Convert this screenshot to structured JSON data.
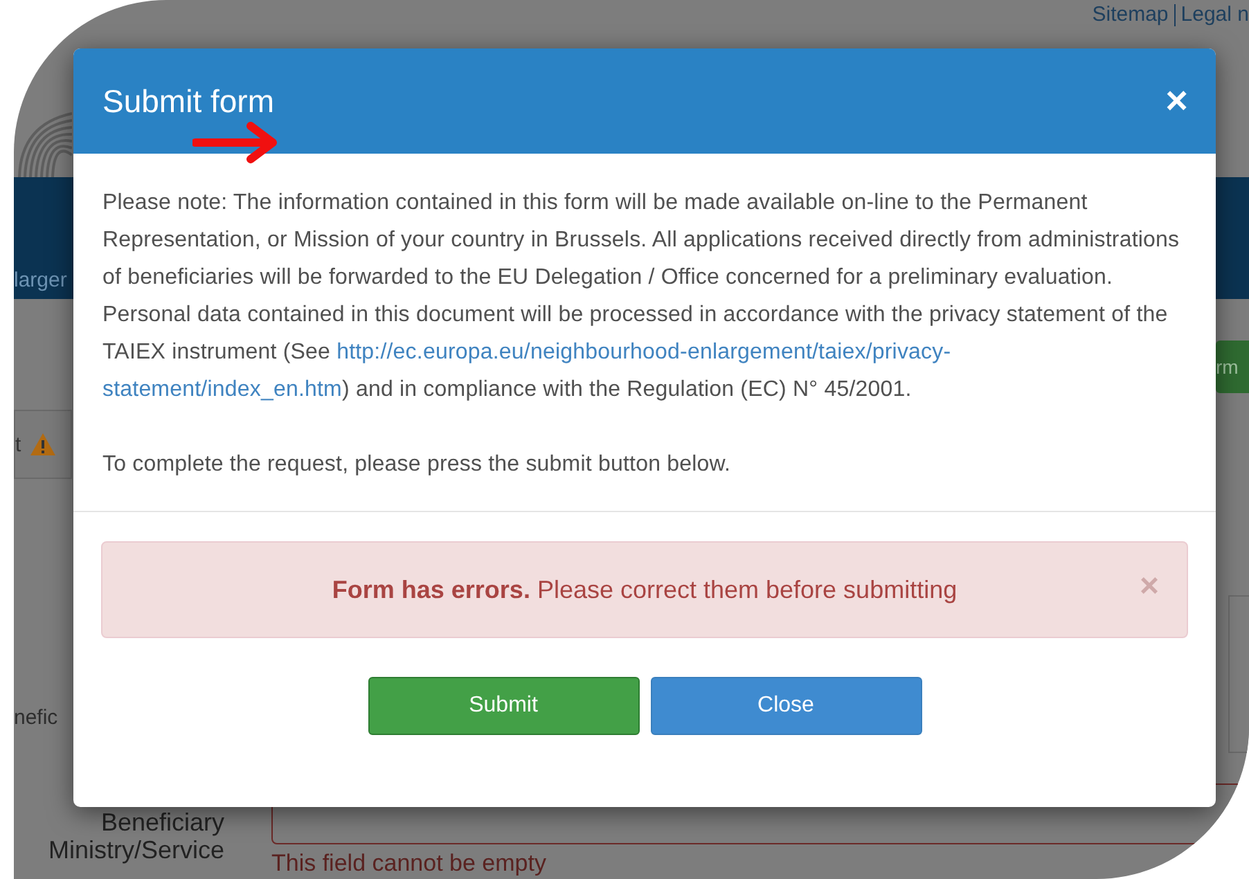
{
  "background_page": {
    "top_links": [
      "Sitemap",
      "Legal n"
    ],
    "nav_fragment": "larger",
    "action_button_fragment": "rm",
    "tab_fragment": "t",
    "label_fragment": "nefic",
    "field_label_lines": [
      "Beneficiary",
      "Ministry/Service"
    ],
    "field_error": "This field cannot be empty"
  },
  "modal": {
    "title": "Submit form",
    "close_symbol": "×",
    "notice_before_link": "Please note: The information contained in this form will be made available on-line to the Permanent Representation, or Mission of your country in Brussels. All applications received directly from administrations of beneficiaries will be forwarded to the EU Delegation / Office concerned for a preliminary evaluation. Personal data contained in this document will be processed in accordance with the privacy statement of the TAIEX instrument (See ",
    "notice_link_lines": [
      "http://ec.europa.eu/neighbourhood-enlargement/taiex/privacy-",
      "statement/index_en.htm"
    ],
    "notice_after_link": ") and in compliance with the Regulation (EC) N° 45/2001.",
    "instruction": "To complete the request, please press the submit button below.",
    "alert": {
      "message": "**Form has errors.** Please correct them before submitting",
      "close_symbol": "×"
    },
    "buttons": [
      {
        "label": "Submit",
        "kind": "primary"
      },
      {
        "label": "Close",
        "kind": "secondary"
      }
    ]
  }
}
